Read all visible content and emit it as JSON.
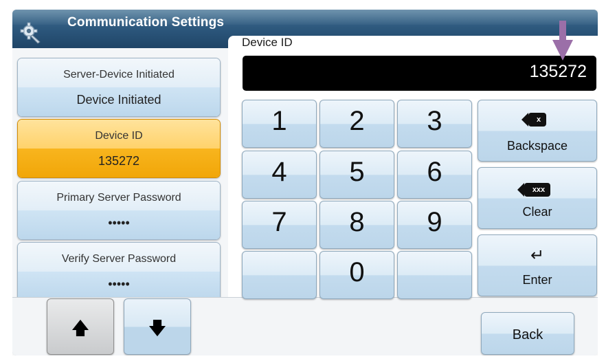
{
  "header": {
    "title": "Communication Settings",
    "icon": "gear-wrench-icon"
  },
  "device_id_panel": {
    "label": "Device ID",
    "display_value": "135272"
  },
  "settings": [
    {
      "name": "Server-Device Initiated",
      "value": "Device Initiated",
      "active": false
    },
    {
      "name": "Device ID",
      "value": "135272",
      "active": true
    },
    {
      "name": "Primary Server Password",
      "value": "•••••",
      "active": false
    },
    {
      "name": "Verify Server Password",
      "value": "•••••",
      "active": false
    }
  ],
  "keypad": {
    "digits": [
      "1",
      "2",
      "3",
      "4",
      "5",
      "6",
      "7",
      "8",
      "9",
      "",
      "0",
      ""
    ],
    "backspace_label": "Backspace",
    "backspace_icon_text": "x",
    "clear_label": "Clear",
    "clear_icon_text": "xxx",
    "enter_label": "Enter"
  },
  "nav": {
    "up_icon": "arrow-up-icon",
    "down_icon": "arrow-down-icon"
  },
  "back_label": "Back",
  "colors": {
    "active_top": "#ffd26b",
    "active_bottom": "#f1a608",
    "header": "#2b557a",
    "annotation_arrow": "#9b6fa8"
  }
}
